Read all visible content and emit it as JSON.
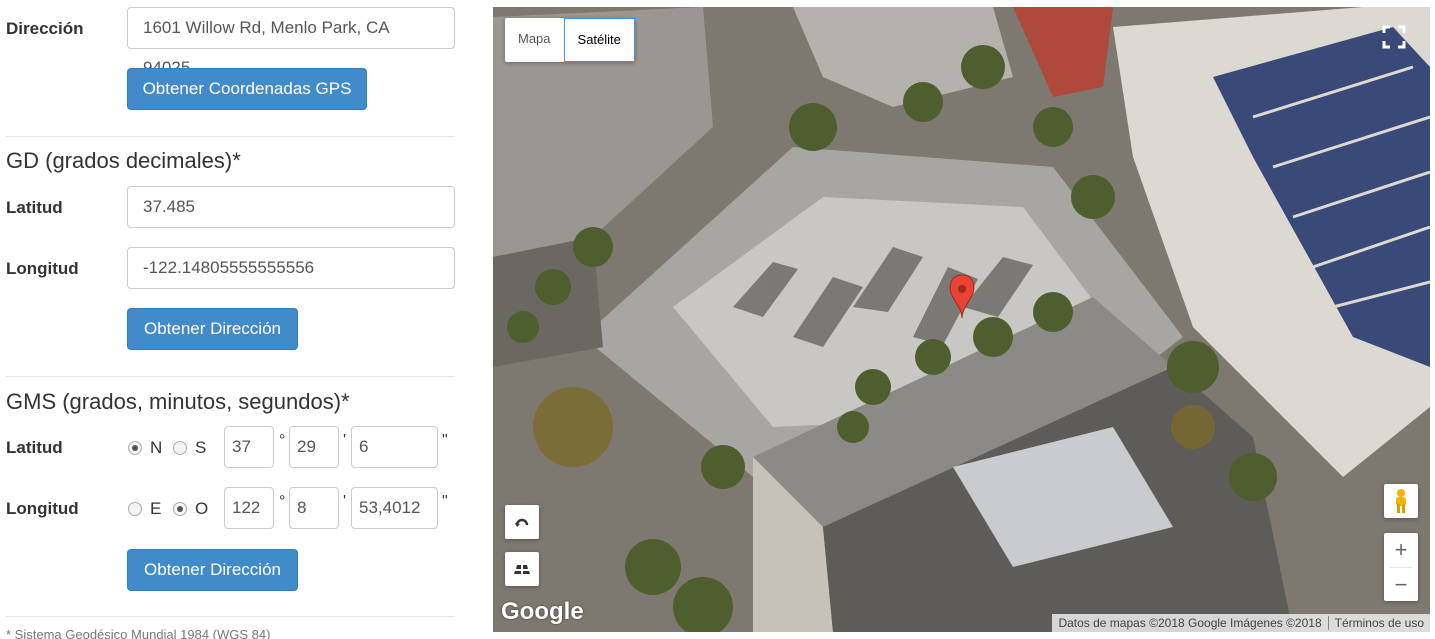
{
  "address": {
    "label": "Dirección",
    "value": "1601 Willow Rd, Menlo Park, CA 94025",
    "button": "Obtener Coordenadas GPS"
  },
  "gd": {
    "heading": "GD (grados decimales)*",
    "lat_label": "Latitud",
    "lat_value": "37.485",
    "lon_label": "Longitud",
    "lon_value": "-122.14805555555556",
    "button": "Obtener Dirección"
  },
  "gms": {
    "heading": "GMS (grados, minutos, segundos)*",
    "lat_label": "Latitud",
    "lat_opt1": "N",
    "lat_opt2": "S",
    "lat_selected": "N",
    "lat_deg": "37",
    "lat_min": "29",
    "lat_sec": "6",
    "lon_label": "Longitud",
    "lon_opt1": "E",
    "lon_opt2": "O",
    "lon_selected": "O",
    "lon_deg": "122",
    "lon_min": "8",
    "lon_sec": "53,4012",
    "deg_symbol": "°",
    "min_symbol": "'",
    "sec_symbol": "\"",
    "button": "Obtener Dirección"
  },
  "footnote": "* Sistema Geodésico Mundial 1984 (WGS 84)",
  "map": {
    "type_map": "Mapa",
    "type_satellite": "Satélite",
    "active_type": "Satélite",
    "google_logo": "Google",
    "attribution": "Datos de mapas ©2018 Google Imágenes ©2018",
    "terms": "Términos de uso",
    "zoom_in": "+",
    "zoom_out": "−"
  }
}
